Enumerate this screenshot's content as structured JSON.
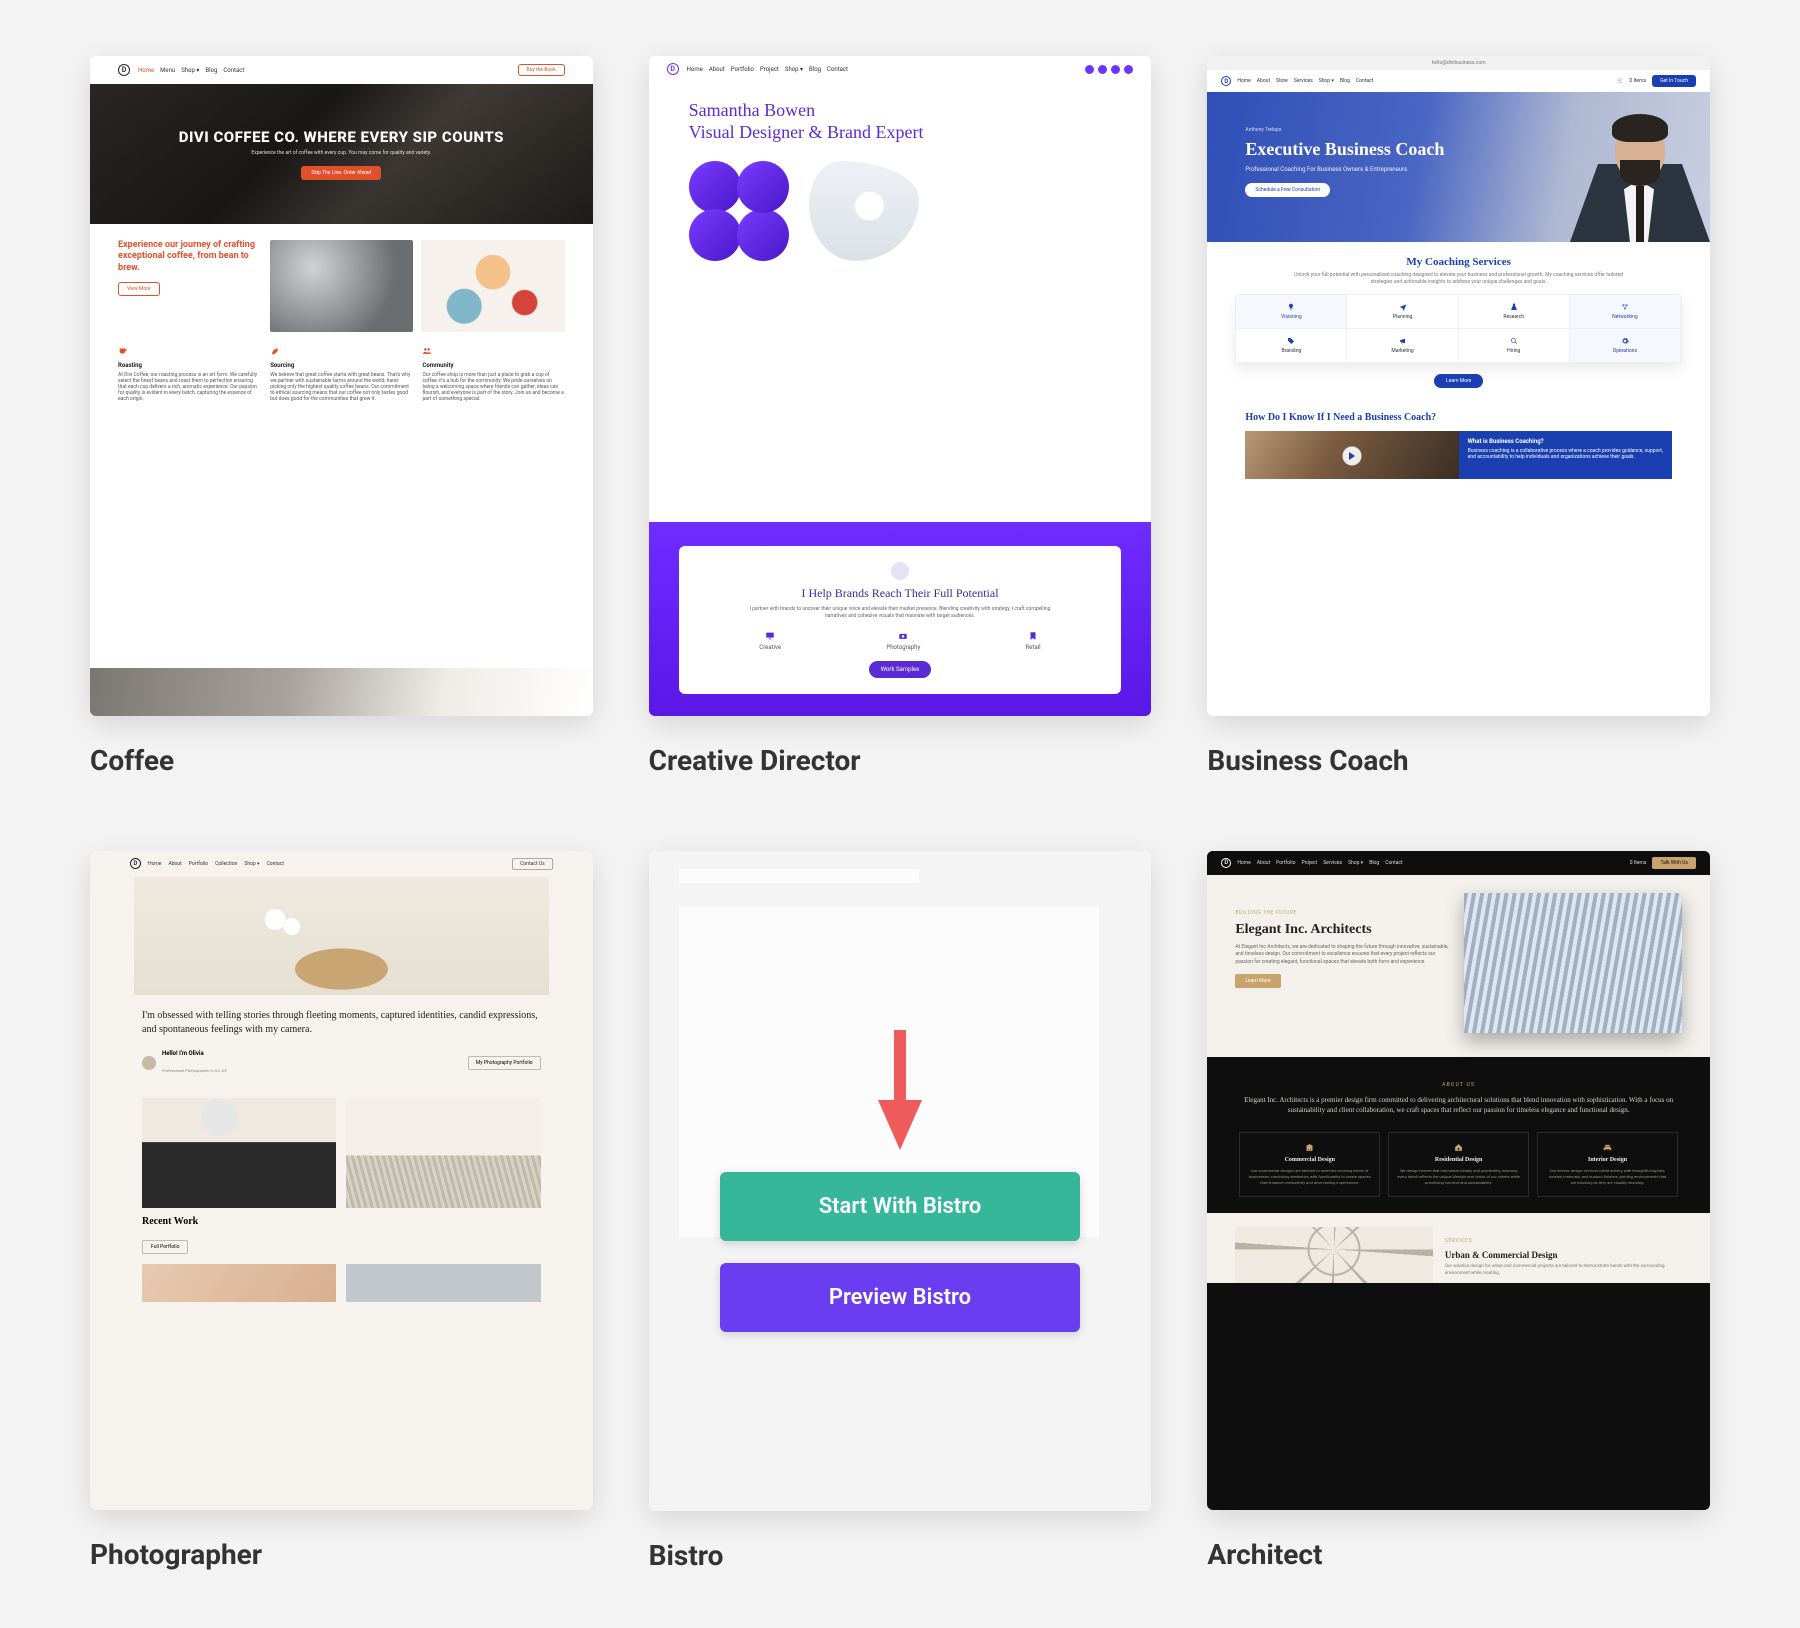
{
  "cards": {
    "coffee": {
      "title": "Coffee",
      "nav": [
        "Home",
        "Menu",
        "Shop ▾",
        "Blog",
        "Contact"
      ],
      "nav_cta": "Buy the Book",
      "hero_title": "DIVI COFFEE CO. WHERE EVERY SIP COUNTS",
      "hero_sub": "Experience the art of coffee with every cup. You may come for quality and variety.",
      "hero_btn": "Skip The Line. Order Ahead",
      "mid_headline": "Experience our journey of crafting exceptional coffee, from bean to brew.",
      "mid_btn": "View More",
      "cols": [
        {
          "icon": "cup",
          "title": "Roasting",
          "text": "At Divi Coffee, our roasting process is an art form. We carefully select the finest beans and roast them to perfection ensuring that each cup delivers a rich, aromatic experience. Our passion for quality is evident in every batch, capturing the essence of each origin."
        },
        {
          "icon": "leaf",
          "title": "Sourcing",
          "text": "We believe that great coffee starts with great beans. That's why we partner with sustainable farms around the world, hand-picking only the highest quality coffee beans. Our commitment to ethical sourcing means that our coffee not only tastes good but does good for the communities that grow it."
        },
        {
          "icon": "people",
          "title": "Community",
          "text": "Our coffee shop is more than just a place to grab a cup of coffee: it's a hub for the community. We pride ourselves on being a welcoming space where friends can gather, ideas can flourish, and everyone is part of the story. Join us and become a part of something special."
        }
      ]
    },
    "creative": {
      "title": "Creative Director",
      "nav": [
        "Home",
        "About",
        "Portfolio",
        "Project",
        "Shop ▾",
        "Blog",
        "Contact"
      ],
      "hero_line": "Samantha Bowen\nVisual Designer & Brand Expert",
      "panel_title": "I Help Brands Reach Their Full Potential",
      "panel_text": "I partner with brands to uncover their unique voice and elevate their market presence. Blending creativity with strategy, I craft compelling narratives and cohesive visuals that resonate with target audiences.",
      "panel_items": [
        "Creative",
        "Photography",
        "Retail"
      ],
      "panel_btn": "Work Samples"
    },
    "coach": {
      "title": "Business Coach",
      "url": "hello@divibusiness.com",
      "nav": [
        "Home",
        "About",
        "Store",
        "Services",
        "Shop ▾",
        "Blog",
        "Contact",
        "0 Items"
      ],
      "nav_cta": "Get In Touch",
      "eyebrow": "Anthony Trelops",
      "hero_title": "Executive Business Coach",
      "hero_sub": "Professional Coaching For Business Owners & Entrepreneurs",
      "hero_btn": "Schedule a Free Consultation",
      "svc_heading": "My Coaching Services",
      "svc_sub": "Unlock your full potential with personalized coaching designed to elevate your business and professional growth. My coaching services offer tailored strategies and actionable insights to address your unique challenges and goals.",
      "svc": [
        "Visioning",
        "Planning",
        "Research",
        "Networking",
        "Branding",
        "Marketing",
        "Hiring",
        "Operations"
      ],
      "learn_more": "Learn More",
      "lower_heading": "How Do I Know If I Need a Business Coach?",
      "lower_card_title": "What is Business Coaching?",
      "lower_card_text": "Business coaching is a collaborative process where a coach provides guidance, support, and accountability to help individuals and organizations achieve their goals."
    },
    "photog": {
      "title": "Photographer",
      "nav": [
        "Home",
        "About",
        "Portfolio",
        "Collection",
        "Shop ▾",
        "Contact"
      ],
      "nav_cta": "Contact Us",
      "intro": "I'm obsessed with telling stories through fleeting moments, captured identities, candid expressions, and spontaneous feelings with my camera.",
      "name": "Hello! I'm Olivia",
      "role": "Professional Photographer in CA, US",
      "byline_btn": "My Photography Portfolio",
      "recent": "Recent Work",
      "recent_btn": "Full Portfolio"
    },
    "bistro": {
      "title": "Bistro",
      "start": "Start With Bistro",
      "preview": "Preview Bistro"
    },
    "arch": {
      "title": "Architect",
      "nav": [
        "Home",
        "About",
        "Portfolio",
        "Project",
        "Services",
        "Shop ▾",
        "Blog",
        "Contact",
        "0 Items"
      ],
      "nav_cta": "Talk With Us",
      "eyebrow": "Building The Future",
      "hero_title": "Elegant Inc. Architects",
      "hero_text": "At Elegant Inc Architects, we are dedicated to shaping the future through innovative, sustainable, and timeless design. Our commitment to excellence ensures that every project reflects our passion for creating elegant, functional spaces that elevate both form and experience.",
      "hero_btn": "Learn More",
      "about_eyebrow": "About Us",
      "about_text": "Elegant Inc. Architects is a premier design firm committed to delivering architectural solutions that blend innovation with sophistication. With a focus on sustainability and client collaboration, we craft spaces that reflect our passion for timeless elegance and functional design.",
      "svc": [
        {
          "t": "Commercial Design",
          "d": "Our commercial designs are tailored to meet the evolving needs of businesses, combining aesthetics with functionality to create spaces that enhance productivity and drive lasting impressions."
        },
        {
          "t": "Residential Design",
          "d": "We design homes that harmonize beauty and practicality, ensuring every detail reflects the unique lifestyle and vision of our clients while prioritizing comfort and sustainability."
        },
        {
          "t": "Interior Design",
          "d": "Our interior design services blend artistry with thoughtful layouts, curated materials, and custom finishes, yielding environments that are inspiring as they are visually stunning."
        }
      ],
      "foot_eyebrow": "Services",
      "foot_title": "Urban & Commercial Design",
      "foot_text": "Our solution design for urban and commercial projects are tailored to demonstrate hands with the surrounding environment while creating."
    }
  }
}
